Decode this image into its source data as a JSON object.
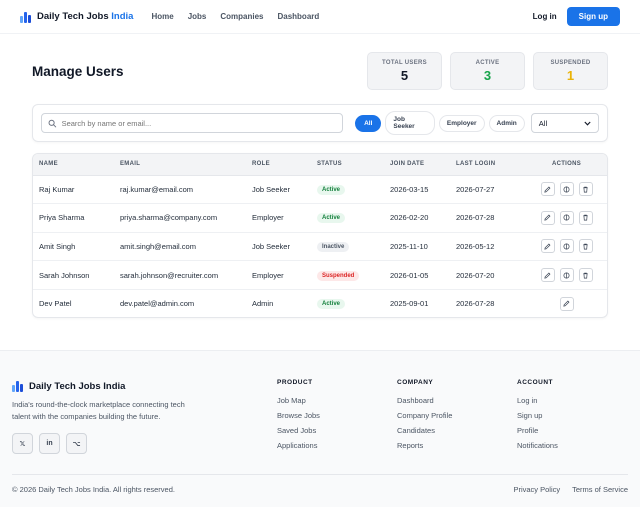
{
  "header": {
    "brand_name": "Daily Tech Jobs",
    "brand_accent": "India",
    "nav": [
      "Home",
      "Jobs",
      "Companies",
      "Dashboard"
    ],
    "login_label": "Log in",
    "signup_label": "Sign up"
  },
  "page": {
    "title": "Manage Users"
  },
  "stats": [
    {
      "label": "Total Users",
      "value": "5",
      "color": "#111827"
    },
    {
      "label": "Active",
      "value": "3",
      "color": "#16a34a"
    },
    {
      "label": "Suspended",
      "value": "1",
      "color": "#eab308"
    }
  ],
  "filters": {
    "search_placeholder": "Search by name or email...",
    "chips": [
      "All",
      "Job Seeker",
      "Employer",
      "Admin"
    ],
    "active_chip": "All",
    "status_select": "All"
  },
  "table": {
    "columns": [
      "Name",
      "Email",
      "Role",
      "Status",
      "Join Date",
      "Last Login",
      "Actions"
    ],
    "rows": [
      {
        "name": "Raj Kumar",
        "email": "raj.kumar@email.com",
        "role": "Job Seeker",
        "status": "Active",
        "join": "2026-03-15",
        "last": "2026-07-27"
      },
      {
        "name": "Priya Sharma",
        "email": "priya.sharma@company.com",
        "role": "Employer",
        "status": "Active",
        "join": "2026-02-20",
        "last": "2026-07-28"
      },
      {
        "name": "Amit Singh",
        "email": "amit.singh@email.com",
        "role": "Job Seeker",
        "status": "Inactive",
        "join": "2025-11-10",
        "last": "2026-05-12"
      },
      {
        "name": "Sarah Johnson",
        "email": "sarah.johnson@recruiter.com",
        "role": "Employer",
        "status": "Suspended",
        "join": "2026-01-05",
        "last": "2026-07-20"
      },
      {
        "name": "Dev Patel",
        "email": "dev.patel@admin.com",
        "role": "Admin",
        "status": "Active",
        "join": "2025-09-01",
        "last": "2026-07-28"
      }
    ]
  },
  "footer": {
    "brand_name": "Daily Tech Jobs India",
    "description": "India's round-the-clock marketplace connecting tech talent with the companies building the future.",
    "socials": [
      "𝕏",
      "in",
      "⌥"
    ],
    "columns": [
      {
        "title": "Product",
        "links": [
          "Job Map",
          "Browse Jobs",
          "Saved Jobs",
          "Applications"
        ]
      },
      {
        "title": "Company",
        "links": [
          "Dashboard",
          "Company Profile",
          "Candidates",
          "Reports"
        ]
      },
      {
        "title": "Account",
        "links": [
          "Log in",
          "Sign up",
          "Profile",
          "Notifications"
        ]
      }
    ],
    "copyright": "© 2026 Daily Tech Jobs India. All rights reserved.",
    "legal": [
      "Privacy Policy",
      "Terms of Service"
    ]
  }
}
